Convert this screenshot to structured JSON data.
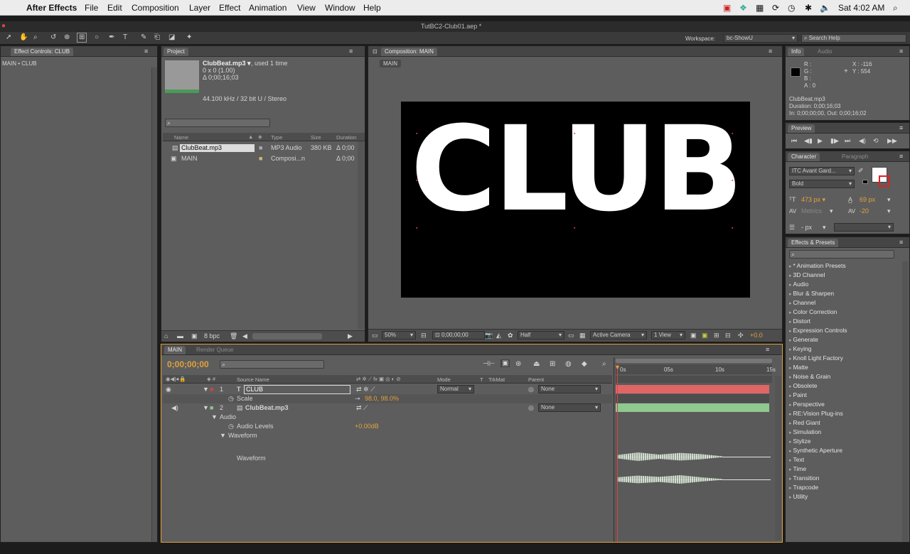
{
  "menubar": {
    "app": "After Effects",
    "items": [
      "File",
      "Edit",
      "Composition",
      "Layer",
      "Effect",
      "Animation",
      "View",
      "Window",
      "Help"
    ],
    "clock": "Sat 4:02 AM"
  },
  "window": {
    "title": "TutBC2-Club01.aep *"
  },
  "toolbar": {
    "workspace_label": "Workspace:",
    "workspace_value": "bc-ShowU",
    "search_placeholder": "Search Help"
  },
  "effect_controls": {
    "tab": "Effect Controls: CLUB",
    "breadcrumb": "MAIN • CLUB"
  },
  "project": {
    "tab": "Project",
    "file_name": "ClubBeat.mp3 ▾",
    "used": ", used 1 time",
    "dims": "0 x 0 (1.00)",
    "duration": "Δ 0;00;16;03",
    "audio_info": "44.100 kHz / 32 bit U / Stereo",
    "columns": [
      "Name",
      "Type",
      "Size",
      "Duration"
    ],
    "items": [
      {
        "name": "ClubBeat.mp3",
        "type": "MP3 Audio",
        "size": "380 KB",
        "duration": "Δ 0;00"
      },
      {
        "name": "MAIN",
        "type": "Composi...n",
        "size": "",
        "duration": "Δ 0;00"
      }
    ],
    "bpc": "8 bpc"
  },
  "composition": {
    "tab": "Composition: MAIN",
    "subtab": "MAIN",
    "text": "CLUB",
    "zoom": "50%",
    "time": "0;00;00;00",
    "resolution": "Half",
    "camera": "Active Camera",
    "views": "1 View",
    "exposure": "+0.0"
  },
  "info": {
    "tab": "Info",
    "tab2": "Audio",
    "r": "R :",
    "g": "G :",
    "b": "B :",
    "a": "A : 0",
    "x": "X : -116",
    "y": "Y : 554",
    "file": "ClubBeat.mp3",
    "duration": "Duration: 0;00;16;03",
    "inout": "In: 0;00;00;00, Out: 0;00;16;02"
  },
  "preview": {
    "tab": "Preview"
  },
  "character": {
    "tab": "Character",
    "tab2": "Paragraph",
    "font": "ITC Avant Gard...",
    "style": "Bold",
    "size": "473 px ▾",
    "leading": "69 px",
    "kerning": "Metrics",
    "tracking": "-20",
    "stroke": "- px"
  },
  "effects": {
    "tab": "Effects & Presets",
    "items": [
      "* Animation Presets",
      "3D Channel",
      "Audio",
      "Blur & Sharpen",
      "Channel",
      "Color Correction",
      "Distort",
      "Expression Controls",
      "Generate",
      "Keying",
      "Knoll Light Factory",
      "Matte",
      "Noise & Grain",
      "Obsolete",
      "Paint",
      "Perspective",
      "RE:Vision Plug-ins",
      "Red Giant",
      "Simulation",
      "Stylize",
      "Synthetic Aperture",
      "Text",
      "Time",
      "Transition",
      "Trapcode",
      "Utility"
    ]
  },
  "timeline": {
    "tab": "MAIN",
    "tab2": "Render Queue",
    "timecode": "0;00;00;00",
    "cols": {
      "source": "Source Name",
      "mode": "Mode",
      "t": "T",
      "trkmat": "TrkMat",
      "parent": "Parent"
    },
    "layers": [
      {
        "num": "1",
        "name": "CLUB",
        "mode": "Normal",
        "parent": "None"
      },
      {
        "num": "2",
        "name": "ClubBeat.mp3",
        "parent": "None"
      }
    ],
    "scale_label": "Scale",
    "scale_value": "98.0, 98.0%",
    "audio_label": "Audio",
    "audio_levels_label": "Audio Levels",
    "audio_levels_value": "+0.00dB",
    "waveform_label": "Waveform",
    "waveform_sub": "Waveform",
    "ruler": [
      "0s",
      "05s",
      "10s",
      "15s"
    ]
  }
}
